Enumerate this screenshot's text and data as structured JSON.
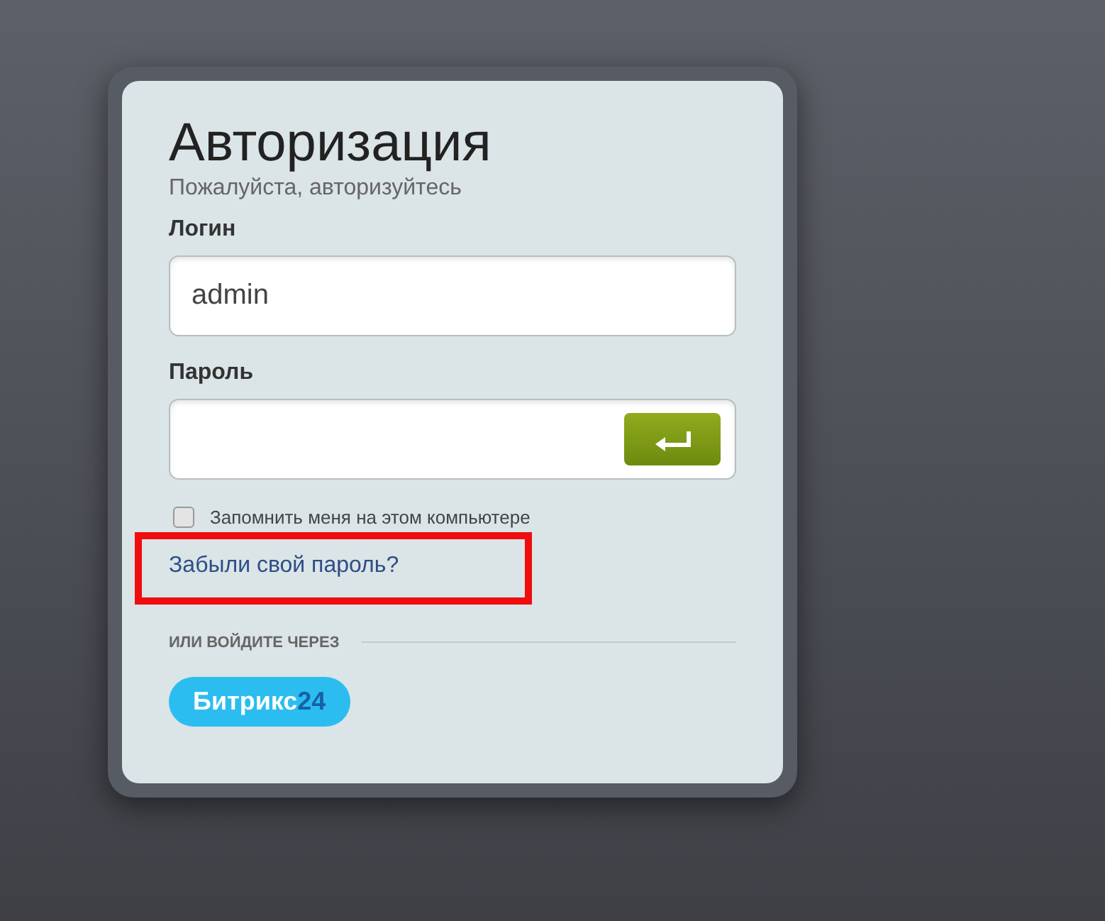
{
  "title": "Авторизация",
  "subtitle": "Пожалуйста, авторизуйтесь",
  "login": {
    "label": "Логин",
    "value": "admin"
  },
  "password": {
    "label": "Пароль"
  },
  "remember": {
    "label": "Запомнить меня на этом компьютере",
    "checked": false
  },
  "forgot_link": {
    "label": "Забыли свой пароль?",
    "highlighted": true
  },
  "alt_login": {
    "label": "ИЛИ ВОЙДИТЕ ЧЕРЕЗ",
    "button": {
      "name": "Битрикс",
      "number": "24"
    }
  }
}
